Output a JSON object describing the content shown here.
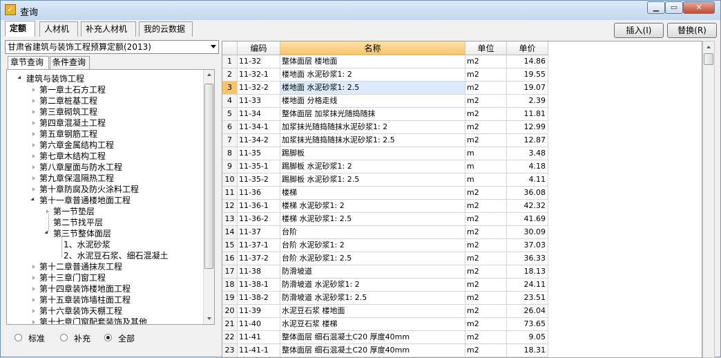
{
  "window": {
    "title": "查询",
    "controls": {
      "minimize": "▁",
      "maximize": "▭",
      "close": "✕"
    }
  },
  "tabs": [
    {
      "label": "定额",
      "active": true
    },
    {
      "label": "人材机",
      "active": false
    },
    {
      "label": "补充人材机",
      "active": false
    },
    {
      "label": "我的云数据",
      "active": false
    }
  ],
  "buttons": {
    "insert": "插入(I)",
    "replace": "替换(R)"
  },
  "library": {
    "selected": "甘肃省建筑与装饰工程预算定额(2013)"
  },
  "subtabs": [
    {
      "label": "章节查询",
      "active": true
    },
    {
      "label": "条件查询",
      "active": false
    }
  ],
  "tree": {
    "root": "建筑与装饰工程",
    "chapters": [
      "第一章土石方工程",
      "第二章桩基工程",
      "第三章砌筑工程",
      "第四章混凝土工程",
      "第五章钢筋工程",
      "第六章金属结构工程",
      "第七章木结构工程",
      "第八章屋面与防水工程",
      "第九章保温隔热工程",
      "第十章防腐及防火涂料工程",
      "第十一章普通楼地面工程"
    ],
    "sections": [
      "第一节垫层",
      "第二节找平层",
      "第三节整体面层"
    ],
    "items": [
      "1、水泥砂浆",
      "2、水泥豆石浆、细石混凝土"
    ],
    "chapters_after": [
      "第十二章普通抹灰工程",
      "第十三章门窗工程",
      "第十四章装饰楼地面工程",
      "第十五章装饰墙柱面工程",
      "第十六章装饰天棚工程",
      "第十七章门窗配套装饰及其他"
    ]
  },
  "filter": {
    "options": [
      {
        "label": "标准",
        "selected": false
      },
      {
        "label": "补充",
        "selected": false
      },
      {
        "label": "全部",
        "selected": true
      }
    ]
  },
  "table": {
    "columns": [
      "",
      "编码",
      "名称",
      "单位",
      "单价"
    ],
    "selected_row": 3,
    "rows": [
      [
        "1",
        "11-32",
        "整体面层 楼地面",
        "m2",
        "14.86"
      ],
      [
        "2",
        "11-32-1",
        "楼地面 水泥砂浆1: 2",
        "m2",
        "19.55"
      ],
      [
        "3",
        "11-32-2",
        "楼地面 水泥砂浆1: 2.5",
        "m2",
        "19.07"
      ],
      [
        "4",
        "11-33",
        "楼地面 分格走线",
        "m2",
        "2.39"
      ],
      [
        "5",
        "11-34",
        "整体面层 加浆抹光随捣随抹",
        "m2",
        "11.81"
      ],
      [
        "6",
        "11-34-1",
        "加浆抹光随捣随抹水泥砂浆1: 2",
        "m2",
        "12.99"
      ],
      [
        "7",
        "11-34-2",
        "加浆抹光随捣随抹水泥砂浆1: 2.5",
        "m2",
        "12.87"
      ],
      [
        "8",
        "11-35",
        "踢脚板",
        "m",
        "3.48"
      ],
      [
        "9",
        "11-35-1",
        "踢脚板 水泥砂浆1: 2",
        "m",
        "4.18"
      ],
      [
        "10",
        "11-35-2",
        "踢脚板 水泥砂浆1: 2.5",
        "m",
        "4.11"
      ],
      [
        "11",
        "11-36",
        "楼梯",
        "m2",
        "36.08"
      ],
      [
        "12",
        "11-36-1",
        "楼梯 水泥砂浆1: 2",
        "m2",
        "42.32"
      ],
      [
        "13",
        "11-36-2",
        "楼梯 水泥砂浆1: 2.5",
        "m2",
        "41.69"
      ],
      [
        "14",
        "11-37",
        "台阶",
        "m2",
        "30.09"
      ],
      [
        "15",
        "11-37-1",
        "台阶 水泥砂浆1: 2",
        "m2",
        "37.03"
      ],
      [
        "16",
        "11-37-2",
        "台阶 水泥砂浆1: 2.5",
        "m2",
        "36.33"
      ],
      [
        "17",
        "11-38",
        "防滑坡道",
        "m2",
        "18.13"
      ],
      [
        "18",
        "11-38-1",
        "防滑坡道 水泥砂浆1: 2",
        "m2",
        "24.11"
      ],
      [
        "19",
        "11-38-2",
        "防滑坡道 水泥砂浆1: 2.5",
        "m2",
        "23.51"
      ],
      [
        "20",
        "11-39",
        "水泥豆石浆 楼地面",
        "m2",
        "26.04"
      ],
      [
        "21",
        "11-40",
        "水泥豆石浆 楼梯",
        "m2",
        "73.65"
      ],
      [
        "22",
        "11-41",
        "整体面层 细石混凝土C20 厚度40mm",
        "m2",
        "9.05"
      ],
      [
        "23",
        "11-41-1",
        "整体面层 细石混凝土C20 厚度40mm",
        "m2",
        "18.31"
      ]
    ]
  }
}
